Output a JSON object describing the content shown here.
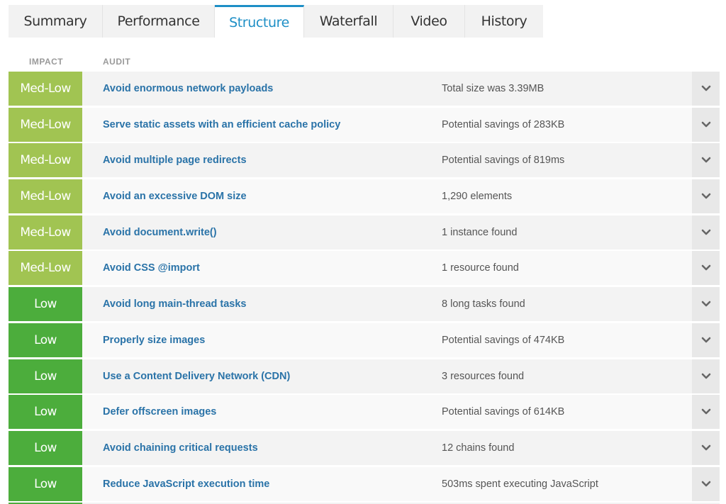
{
  "tabs": [
    {
      "label": "Summary",
      "active": false
    },
    {
      "label": "Performance",
      "active": false
    },
    {
      "label": "Structure",
      "active": true
    },
    {
      "label": "Waterfall",
      "active": false
    },
    {
      "label": "Video",
      "active": false
    },
    {
      "label": "History",
      "active": false
    }
  ],
  "columns": {
    "impact": "IMPACT",
    "audit": "AUDIT"
  },
  "colors": {
    "accent": "#1e8fc6",
    "med_low": "#a1c452",
    "low": "#4cad3c",
    "link": "#2a73a8"
  },
  "rows": [
    {
      "impact": "Med-Low",
      "level": "medlow",
      "audit": "Avoid enormous network payloads",
      "detail": "Total size was 3.39MB"
    },
    {
      "impact": "Med-Low",
      "level": "medlow",
      "audit": "Serve static assets with an efficient cache policy",
      "detail": "Potential savings of 283KB"
    },
    {
      "impact": "Med-Low",
      "level": "medlow",
      "audit": "Avoid multiple page redirects",
      "detail": "Potential savings of 819ms"
    },
    {
      "impact": "Med-Low",
      "level": "medlow",
      "audit": "Avoid an excessive DOM size",
      "detail": "1,290 elements"
    },
    {
      "impact": "Med-Low",
      "level": "medlow",
      "audit": "Avoid document.write()",
      "detail": "1 instance found"
    },
    {
      "impact": "Med-Low",
      "level": "medlow",
      "audit": "Avoid CSS @import",
      "detail": "1 resource found"
    },
    {
      "impact": "Low",
      "level": "low",
      "audit": "Avoid long main-thread tasks",
      "detail": "8 long tasks found"
    },
    {
      "impact": "Low",
      "level": "low",
      "audit": "Properly size images",
      "detail": "Potential savings of 474KB"
    },
    {
      "impact": "Low",
      "level": "low",
      "audit": "Use a Content Delivery Network (CDN)",
      "detail": "3 resources found"
    },
    {
      "impact": "Low",
      "level": "low",
      "audit": "Defer offscreen images",
      "detail": "Potential savings of 614KB"
    },
    {
      "impact": "Low",
      "level": "low",
      "audit": "Avoid chaining critical requests",
      "detail": "12 chains found"
    },
    {
      "impact": "Low",
      "level": "low",
      "audit": "Reduce JavaScript execution time",
      "detail": "503ms spent executing JavaScript"
    }
  ],
  "icons": {
    "expand": "chevron-down-icon"
  }
}
